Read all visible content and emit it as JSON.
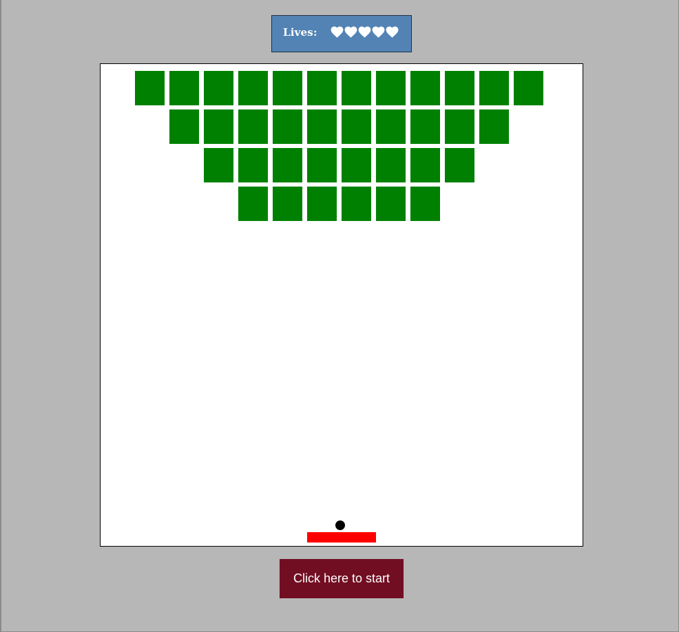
{
  "hud": {
    "lives_label": "Lives:",
    "lives": 5,
    "heart_icon": "heart-icon",
    "panel_color": "#5383b4"
  },
  "board": {
    "background": "#ffffff",
    "brick_color": "#008000",
    "brick_rows": [
      12,
      10,
      8,
      6
    ]
  },
  "paddle": {
    "color": "#ff0000"
  },
  "ball": {
    "color": "#000000"
  },
  "start_button": {
    "label": "Click here to start",
    "color": "#720e22"
  }
}
